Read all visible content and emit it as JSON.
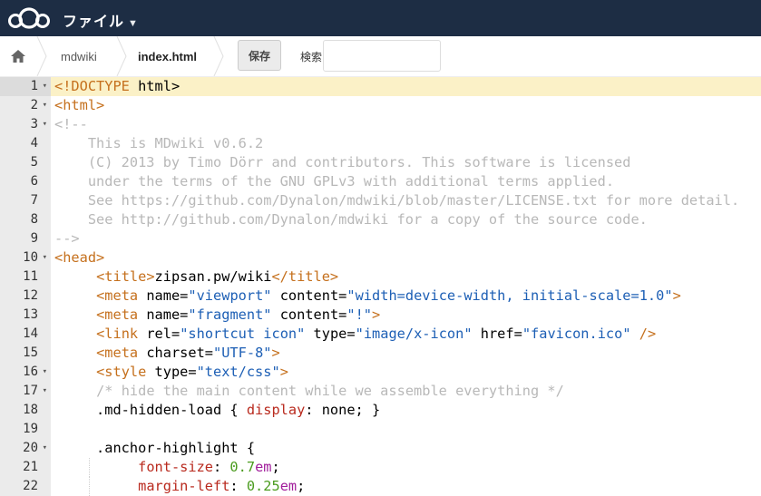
{
  "topbar": {
    "title": "ファイル",
    "caret": "▼",
    "logo": "cloud-logo",
    "background": "#1d2d44"
  },
  "controls": {
    "home_icon": "home-icon",
    "breadcrumb": [
      "mdwiki",
      "index.html"
    ],
    "save_label": "保存",
    "search_label": "検索",
    "search_value": ""
  },
  "editor": {
    "active_line": 1,
    "colors": {
      "tag": "#c5701d",
      "string": "#1d5fb5",
      "comment": "#b8b8b8",
      "css_property": "#b92a1e",
      "number": "#4a9b1e",
      "unit": "#a11d9b",
      "active_line_bg": "#fbf1c7",
      "gutter_bg": "#ebebeb"
    },
    "lines": [
      {
        "n": "1",
        "fold": "▾",
        "tokens": [
          {
            "t": "<!DOCTYPE",
            "c": "tag"
          },
          {
            "t": " html>",
            "c": "text"
          }
        ]
      },
      {
        "n": "2",
        "fold": "▾",
        "tokens": [
          {
            "t": "<html>",
            "c": "tag"
          }
        ]
      },
      {
        "n": "3",
        "fold": "▾",
        "tokens": [
          {
            "t": "<!--",
            "c": "cmt"
          }
        ]
      },
      {
        "n": "4",
        "fold": "",
        "tokens": [
          {
            "t": "    This is MDwiki v0.6.2",
            "c": "cmt"
          }
        ]
      },
      {
        "n": "5",
        "fold": "",
        "tokens": [
          {
            "t": "    (C) 2013 by Timo Dörr and contributors. This software is licensed",
            "c": "cmt"
          }
        ]
      },
      {
        "n": "6",
        "fold": "",
        "tokens": [
          {
            "t": "    under the terms of the GNU GPLv3 with additional terms applied.",
            "c": "cmt"
          }
        ]
      },
      {
        "n": "7",
        "fold": "",
        "tokens": [
          {
            "t": "    See https://github.com/Dynalon/mdwiki/blob/master/LICENSE.txt for more detail.",
            "c": "cmt"
          }
        ]
      },
      {
        "n": "8",
        "fold": "",
        "tokens": [
          {
            "t": "    See http://github.com/Dynalon/mdwiki for a copy of the source code.",
            "c": "cmt"
          }
        ]
      },
      {
        "n": "9",
        "fold": "",
        "tokens": [
          {
            "t": "-->",
            "c": "cmt"
          }
        ]
      },
      {
        "n": "10",
        "fold": "▾",
        "tokens": [
          {
            "t": "<head>",
            "c": "tag"
          }
        ]
      },
      {
        "n": "11",
        "fold": "",
        "tokens": [
          {
            "t": "     ",
            "c": "text"
          },
          {
            "t": "<title>",
            "c": "tag"
          },
          {
            "t": "zipsan.pw/wiki",
            "c": "text"
          },
          {
            "t": "</title>",
            "c": "tag"
          }
        ]
      },
      {
        "n": "12",
        "fold": "",
        "tokens": [
          {
            "t": "     ",
            "c": "text"
          },
          {
            "t": "<meta",
            "c": "tag"
          },
          {
            "t": " name=",
            "c": "attr"
          },
          {
            "t": "\"viewport\"",
            "c": "str"
          },
          {
            "t": " content=",
            "c": "attr"
          },
          {
            "t": "\"width=device-width, initial-scale=1.0\"",
            "c": "str"
          },
          {
            "t": ">",
            "c": "tag"
          }
        ]
      },
      {
        "n": "13",
        "fold": "",
        "tokens": [
          {
            "t": "     ",
            "c": "text"
          },
          {
            "t": "<meta",
            "c": "tag"
          },
          {
            "t": " name=",
            "c": "attr"
          },
          {
            "t": "\"fragment\"",
            "c": "str"
          },
          {
            "t": " content=",
            "c": "attr"
          },
          {
            "t": "\"!\"",
            "c": "str"
          },
          {
            "t": ">",
            "c": "tag"
          }
        ]
      },
      {
        "n": "14",
        "fold": "",
        "tokens": [
          {
            "t": "     ",
            "c": "text"
          },
          {
            "t": "<link",
            "c": "tag"
          },
          {
            "t": " rel=",
            "c": "attr"
          },
          {
            "t": "\"shortcut icon\"",
            "c": "str"
          },
          {
            "t": " type=",
            "c": "attr"
          },
          {
            "t": "\"image/x-icon\"",
            "c": "str"
          },
          {
            "t": " href=",
            "c": "attr"
          },
          {
            "t": "\"favicon.ico\"",
            "c": "str"
          },
          {
            "t": " />",
            "c": "tag"
          }
        ]
      },
      {
        "n": "15",
        "fold": "",
        "tokens": [
          {
            "t": "     ",
            "c": "text"
          },
          {
            "t": "<meta",
            "c": "tag"
          },
          {
            "t": " charset=",
            "c": "attr"
          },
          {
            "t": "\"UTF-8\"",
            "c": "str"
          },
          {
            "t": ">",
            "c": "tag"
          }
        ]
      },
      {
        "n": "16",
        "fold": "▾",
        "tokens": [
          {
            "t": "     ",
            "c": "text"
          },
          {
            "t": "<style",
            "c": "tag"
          },
          {
            "t": " type=",
            "c": "attr"
          },
          {
            "t": "\"text/css\"",
            "c": "str"
          },
          {
            "t": ">",
            "c": "tag"
          }
        ]
      },
      {
        "n": "17",
        "fold": "▾",
        "tokens": [
          {
            "t": "     ",
            "c": "text"
          },
          {
            "t": "/* hide the main content while we assemble everything */",
            "c": "cmt"
          }
        ]
      },
      {
        "n": "18",
        "fold": "",
        "tokens": [
          {
            "t": "     .md-hidden-load { ",
            "c": "text"
          },
          {
            "t": "display",
            "c": "prop"
          },
          {
            "t": ": none; }",
            "c": "text"
          }
        ]
      },
      {
        "n": "19",
        "fold": "",
        "tokens": []
      },
      {
        "n": "20",
        "fold": "▾",
        "tokens": [
          {
            "t": "     .anchor-highlight {",
            "c": "text"
          }
        ]
      },
      {
        "n": "21",
        "fold": "",
        "guide": true,
        "tokens": [
          {
            "t": "          ",
            "c": "text"
          },
          {
            "t": "font-size",
            "c": "prop"
          },
          {
            "t": ": ",
            "c": "text"
          },
          {
            "t": "0.7",
            "c": "num"
          },
          {
            "t": "em",
            "c": "unit"
          },
          {
            "t": ";",
            "c": "text"
          }
        ]
      },
      {
        "n": "22",
        "fold": "",
        "guide": true,
        "tokens": [
          {
            "t": "          ",
            "c": "text"
          },
          {
            "t": "margin-left",
            "c": "prop"
          },
          {
            "t": ": ",
            "c": "text"
          },
          {
            "t": "0.25",
            "c": "num"
          },
          {
            "t": "em",
            "c": "unit"
          },
          {
            "t": ";",
            "c": "text"
          }
        ]
      }
    ]
  }
}
